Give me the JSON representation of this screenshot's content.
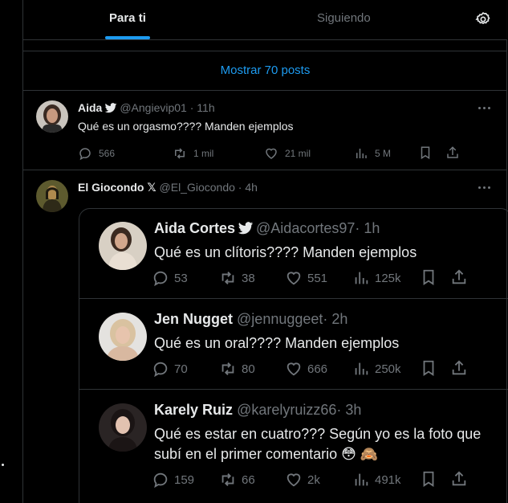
{
  "tabs": {
    "for_you": "Para ti",
    "following": "Siguiendo"
  },
  "show_posts": "Mostrar 70 posts",
  "tweet1": {
    "name": "Aida",
    "handle": "@Angievip01",
    "time": "· 11h",
    "text": "Qué es un orgasmo???? Manden ejemplos",
    "replies": "566",
    "reposts": "1 mil",
    "likes": "21 mil",
    "views": "5 M"
  },
  "tweet2": {
    "name": "El Giocondo",
    "handle": "@El_Giocondo",
    "time": "· 4h",
    "badge": "𝕏"
  },
  "quotes": [
    {
      "name": "Aida Cortes",
      "handle": "@Aidacortes97",
      "time": "· 1h",
      "text": "Qué es un clítoris???? Manden ejemplos",
      "replies": "53",
      "reposts": "38",
      "likes": "551",
      "views": "125k"
    },
    {
      "name": "Jen Nugget",
      "handle": "@jennuggeet",
      "time": "· 2h",
      "text": "Qué es un oral???? Manden ejemplos",
      "replies": "70",
      "reposts": "80",
      "likes": "666",
      "views": "250k"
    },
    {
      "name": "Karely Ruiz",
      "handle": "@karelyruizz66",
      "time": "· 3h",
      "text": "Qué es estar en cuatro??? Según yo es la foto que subí en el primer comentario 😳 🙈",
      "replies": "159",
      "reposts": "66",
      "likes": "2k",
      "views": "491k"
    }
  ],
  "colors": {
    "accent": "#1d9bf0",
    "muted": "#71767b",
    "border": "#2f3336",
    "background": "#000000"
  }
}
